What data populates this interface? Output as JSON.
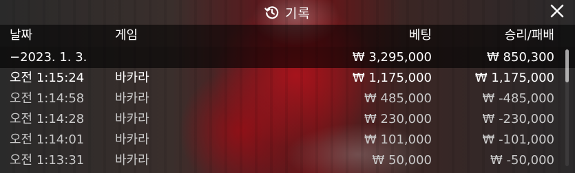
{
  "title": "기록",
  "icons": {
    "history": "history-icon",
    "close": "close-icon"
  },
  "columns": {
    "date": "날짜",
    "game": "게임",
    "bet": "베팅",
    "result": "승리/패배"
  },
  "date_row": {
    "date": "−2023. 1. 3.",
    "bet": "₩ 3,295,000",
    "result": "₩ 850,300"
  },
  "rows": [
    {
      "time": "오전 1:15:24",
      "game": "바카라",
      "bet": "₩ 1,175,000",
      "result": "₩ 1,175,000"
    },
    {
      "time": "오전 1:14:58",
      "game": "바카라",
      "bet": "₩ 485,000",
      "result": "₩ -485,000"
    },
    {
      "time": "오전 1:14:28",
      "game": "바카라",
      "bet": "₩ 230,000",
      "result": "₩ -230,000"
    },
    {
      "time": "오전 1:14:01",
      "game": "바카라",
      "bet": "₩ 101,000",
      "result": "₩ -101,000"
    },
    {
      "time": "오전 1:13:31",
      "game": "바카라",
      "bet": "₩ 50,000",
      "result": "₩ -50,000"
    }
  ]
}
